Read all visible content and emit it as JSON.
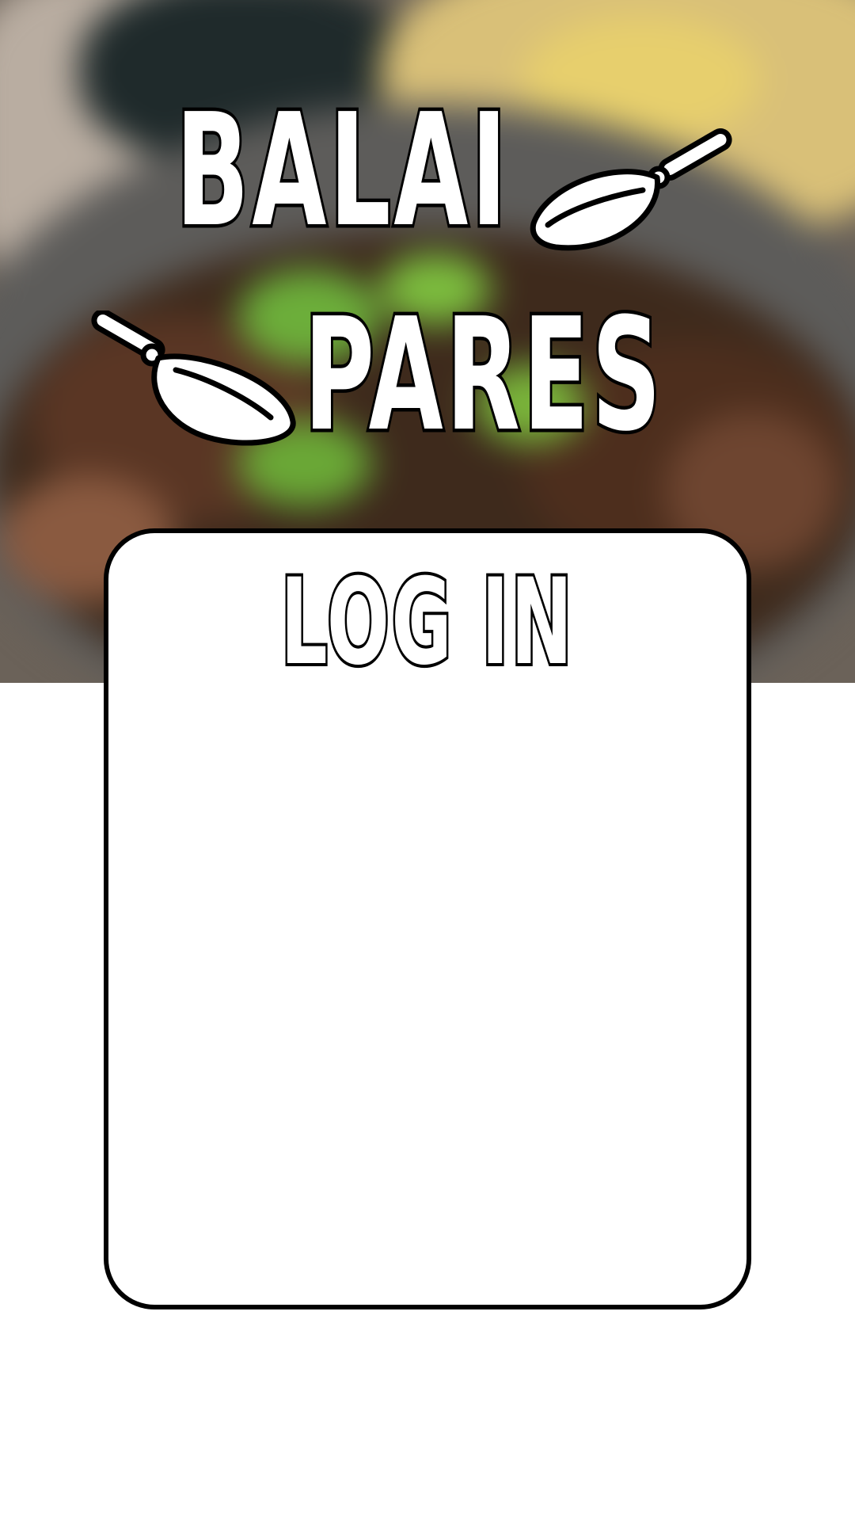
{
  "app": {
    "brand_line_1": "BALAI",
    "brand_line_2": "PARES"
  },
  "login": {
    "title": "LOG IN"
  },
  "icons": {
    "logo_decoration": "frying-pan-icon"
  },
  "colors": {
    "card_background": "#ffffff",
    "outline": "#000000",
    "page_background": "#ffffff"
  }
}
